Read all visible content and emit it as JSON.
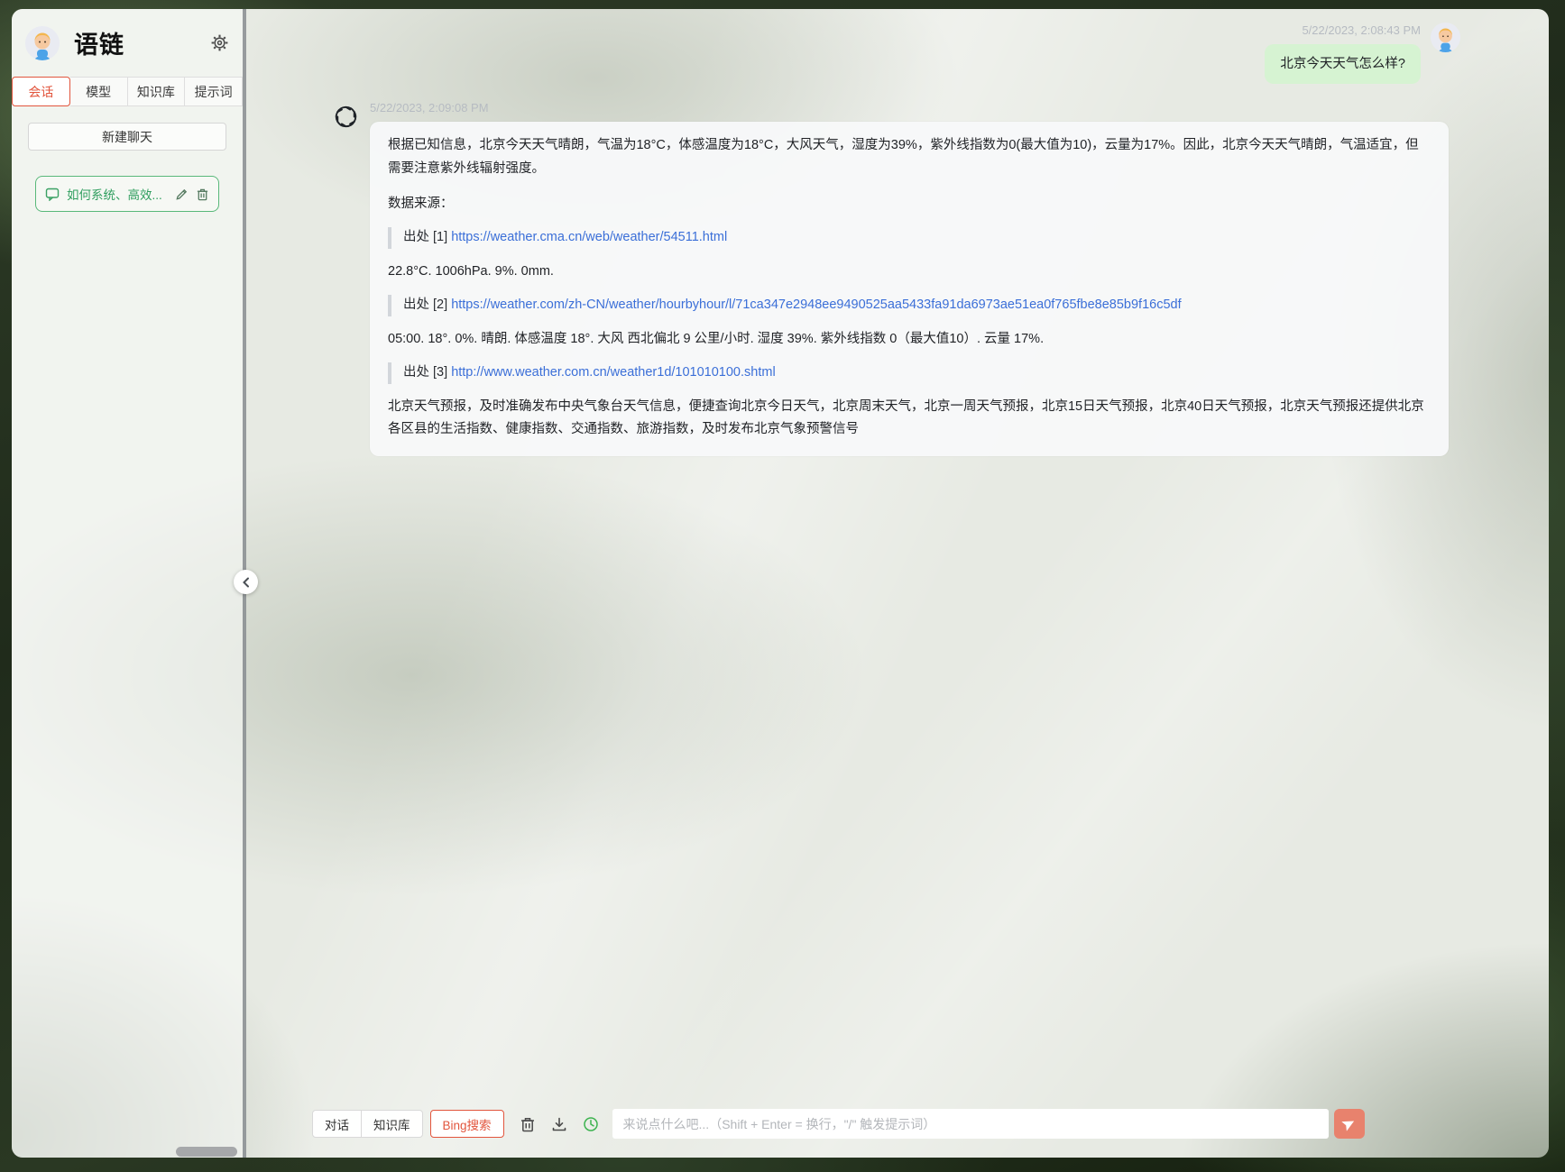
{
  "app": {
    "title": "语链"
  },
  "sidebar": {
    "tabs": [
      {
        "label": "会话",
        "active": true
      },
      {
        "label": "模型",
        "active": false
      },
      {
        "label": "知识库",
        "active": false
      },
      {
        "label": "提示词",
        "active": false
      }
    ],
    "new_chat_label": "新建聊天",
    "chats": [
      {
        "title": "如何系统、高效..."
      }
    ]
  },
  "conversation": {
    "user_message": {
      "timestamp": "5/22/2023, 2:08:43 PM",
      "text": "北京今天天气怎么样?"
    },
    "assistant_message": {
      "timestamp": "5/22/2023, 2:09:08 PM",
      "paragraph1": "根据已知信息，北京今天天气晴朗，气温为18°C，体感温度为18°C，大风天气，湿度为39%，紫外线指数为0(最大值为10)，云量为17%。因此，北京今天天气晴朗，气温适宜，但需要注意紫外线辐射强度。",
      "sources_label": "数据来源：",
      "citations": [
        {
          "label": "出处 [1]",
          "url": "https://weather.cma.cn/web/weather/54511.html",
          "snippet": "22.8°C. 1006hPa. 9%. 0mm."
        },
        {
          "label": "出处 [2]",
          "url": "https://weather.com/zh-CN/weather/hourbyhour/l/71ca347e2948ee9490525aa5433fa91da6973ae51ea0f765fbe8e85b9f16c5df",
          "snippet": "05:00. 18°. 0%. 晴朗. 体感温度 18°. 大风 西北偏北 9 公里/小时. 湿度 39%. 紫外线指数 0（最大值10）. 云量 17%."
        },
        {
          "label": "出处 [3]",
          "url": "http://www.weather.com.cn/weather1d/101010100.shtml",
          "snippet": "北京天气预报，及时准确发布中央气象台天气信息，便捷查询北京今日天气，北京周末天气，北京一周天气预报，北京15日天气预报，北京40日天气预报，北京天气预报还提供北京各区县的生活指数、健康指数、交通指数、旅游指数，及时发布北京气象预警信号"
        }
      ]
    }
  },
  "toolbar": {
    "mode_buttons": [
      {
        "label": "对话"
      },
      {
        "label": "知识库"
      }
    ],
    "bing_label": "Bing搜索",
    "input_placeholder": "来说点什么吧...（Shift + Enter = 换行，\"/\" 触发提示词）"
  },
  "icons": {
    "gear-icon": "⚙",
    "chat-bubble-icon": "💬",
    "edit-icon": "✎",
    "delete-icon": "🗑",
    "chevron-left-icon": "‹",
    "trash-icon": "🗑",
    "download-icon": "⭳",
    "history-clock-icon": "🕓",
    "send-icon": "➤",
    "openai-logo-icon": "✲"
  },
  "colors": {
    "accent_red": "#e2553d",
    "accent_green_border": "#59b87a",
    "accent_green_text": "#2f9e5e",
    "link_blue": "#3b6fd8",
    "user_bubble_green": "#d6f3d2",
    "send_salmon": "#e8826d",
    "history_green": "#3cb34f"
  }
}
